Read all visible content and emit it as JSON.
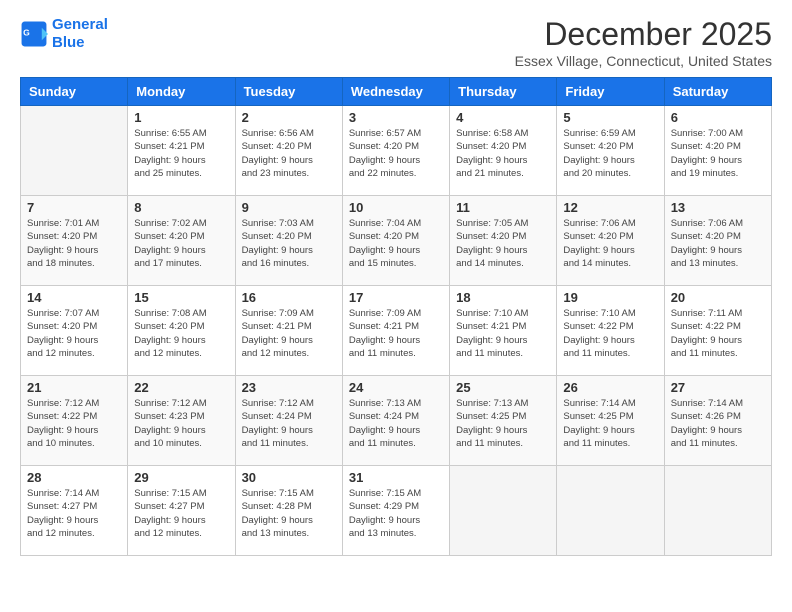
{
  "logo": {
    "line1": "General",
    "line2": "Blue"
  },
  "title": "December 2025",
  "location": "Essex Village, Connecticut, United States",
  "days_of_week": [
    "Sunday",
    "Monday",
    "Tuesday",
    "Wednesday",
    "Thursday",
    "Friday",
    "Saturday"
  ],
  "weeks": [
    [
      {
        "day": "",
        "info": ""
      },
      {
        "day": "1",
        "info": "Sunrise: 6:55 AM\nSunset: 4:21 PM\nDaylight: 9 hours\nand 25 minutes."
      },
      {
        "day": "2",
        "info": "Sunrise: 6:56 AM\nSunset: 4:20 PM\nDaylight: 9 hours\nand 23 minutes."
      },
      {
        "day": "3",
        "info": "Sunrise: 6:57 AM\nSunset: 4:20 PM\nDaylight: 9 hours\nand 22 minutes."
      },
      {
        "day": "4",
        "info": "Sunrise: 6:58 AM\nSunset: 4:20 PM\nDaylight: 9 hours\nand 21 minutes."
      },
      {
        "day": "5",
        "info": "Sunrise: 6:59 AM\nSunset: 4:20 PM\nDaylight: 9 hours\nand 20 minutes."
      },
      {
        "day": "6",
        "info": "Sunrise: 7:00 AM\nSunset: 4:20 PM\nDaylight: 9 hours\nand 19 minutes."
      }
    ],
    [
      {
        "day": "7",
        "info": "Sunrise: 7:01 AM\nSunset: 4:20 PM\nDaylight: 9 hours\nand 18 minutes."
      },
      {
        "day": "8",
        "info": "Sunrise: 7:02 AM\nSunset: 4:20 PM\nDaylight: 9 hours\nand 17 minutes."
      },
      {
        "day": "9",
        "info": "Sunrise: 7:03 AM\nSunset: 4:20 PM\nDaylight: 9 hours\nand 16 minutes."
      },
      {
        "day": "10",
        "info": "Sunrise: 7:04 AM\nSunset: 4:20 PM\nDaylight: 9 hours\nand 15 minutes."
      },
      {
        "day": "11",
        "info": "Sunrise: 7:05 AM\nSunset: 4:20 PM\nDaylight: 9 hours\nand 14 minutes."
      },
      {
        "day": "12",
        "info": "Sunrise: 7:06 AM\nSunset: 4:20 PM\nDaylight: 9 hours\nand 14 minutes."
      },
      {
        "day": "13",
        "info": "Sunrise: 7:06 AM\nSunset: 4:20 PM\nDaylight: 9 hours\nand 13 minutes."
      }
    ],
    [
      {
        "day": "14",
        "info": "Sunrise: 7:07 AM\nSunset: 4:20 PM\nDaylight: 9 hours\nand 12 minutes."
      },
      {
        "day": "15",
        "info": "Sunrise: 7:08 AM\nSunset: 4:20 PM\nDaylight: 9 hours\nand 12 minutes."
      },
      {
        "day": "16",
        "info": "Sunrise: 7:09 AM\nSunset: 4:21 PM\nDaylight: 9 hours\nand 12 minutes."
      },
      {
        "day": "17",
        "info": "Sunrise: 7:09 AM\nSunset: 4:21 PM\nDaylight: 9 hours\nand 11 minutes."
      },
      {
        "day": "18",
        "info": "Sunrise: 7:10 AM\nSunset: 4:21 PM\nDaylight: 9 hours\nand 11 minutes."
      },
      {
        "day": "19",
        "info": "Sunrise: 7:10 AM\nSunset: 4:22 PM\nDaylight: 9 hours\nand 11 minutes."
      },
      {
        "day": "20",
        "info": "Sunrise: 7:11 AM\nSunset: 4:22 PM\nDaylight: 9 hours\nand 11 minutes."
      }
    ],
    [
      {
        "day": "21",
        "info": "Sunrise: 7:12 AM\nSunset: 4:22 PM\nDaylight: 9 hours\nand 10 minutes."
      },
      {
        "day": "22",
        "info": "Sunrise: 7:12 AM\nSunset: 4:23 PM\nDaylight: 9 hours\nand 10 minutes."
      },
      {
        "day": "23",
        "info": "Sunrise: 7:12 AM\nSunset: 4:24 PM\nDaylight: 9 hours\nand 11 minutes."
      },
      {
        "day": "24",
        "info": "Sunrise: 7:13 AM\nSunset: 4:24 PM\nDaylight: 9 hours\nand 11 minutes."
      },
      {
        "day": "25",
        "info": "Sunrise: 7:13 AM\nSunset: 4:25 PM\nDaylight: 9 hours\nand 11 minutes."
      },
      {
        "day": "26",
        "info": "Sunrise: 7:14 AM\nSunset: 4:25 PM\nDaylight: 9 hours\nand 11 minutes."
      },
      {
        "day": "27",
        "info": "Sunrise: 7:14 AM\nSunset: 4:26 PM\nDaylight: 9 hours\nand 11 minutes."
      }
    ],
    [
      {
        "day": "28",
        "info": "Sunrise: 7:14 AM\nSunset: 4:27 PM\nDaylight: 9 hours\nand 12 minutes."
      },
      {
        "day": "29",
        "info": "Sunrise: 7:15 AM\nSunset: 4:27 PM\nDaylight: 9 hours\nand 12 minutes."
      },
      {
        "day": "30",
        "info": "Sunrise: 7:15 AM\nSunset: 4:28 PM\nDaylight: 9 hours\nand 13 minutes."
      },
      {
        "day": "31",
        "info": "Sunrise: 7:15 AM\nSunset: 4:29 PM\nDaylight: 9 hours\nand 13 minutes."
      },
      {
        "day": "",
        "info": ""
      },
      {
        "day": "",
        "info": ""
      },
      {
        "day": "",
        "info": ""
      }
    ]
  ]
}
